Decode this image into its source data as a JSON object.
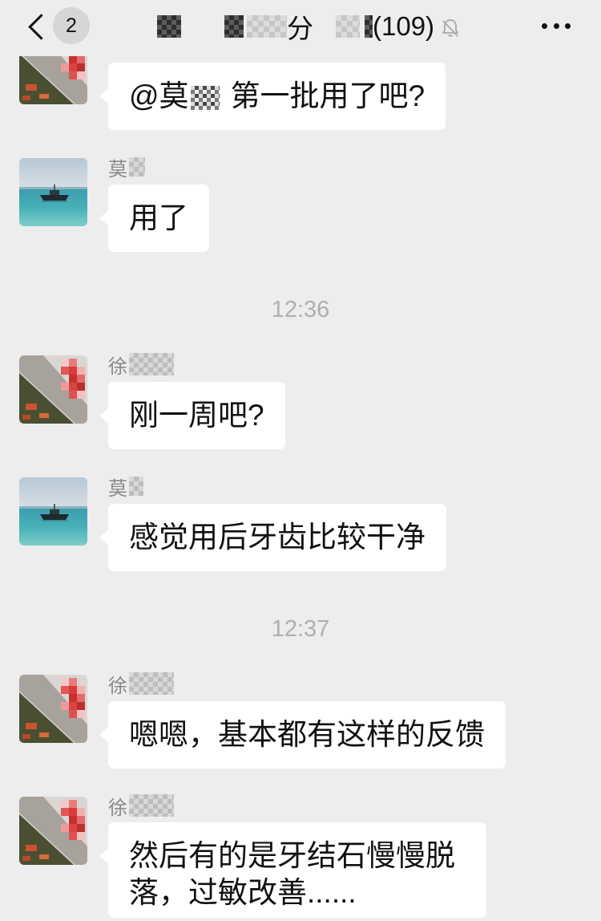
{
  "colors": {
    "background": "#ededed",
    "bubble": "#ffffff",
    "timestamp": "#afafaf",
    "sender_name": "#8a8a8a",
    "badge": "#d6d6d6"
  },
  "header": {
    "back_icon": "chevron-left-icon",
    "unread_badge": "2",
    "title_visible": "分",
    "title_count": "(109)",
    "mute_icon": "bell-off-icon",
    "more_icon": "more-dots-icon"
  },
  "messages": [
    {
      "sender": "",
      "avatar": "red-mosaic-avatar",
      "text_before": "@莫",
      "text_after": "第一批用了吧?"
    },
    {
      "sender": "莫",
      "avatar": "boat-sea-avatar",
      "text": "用了"
    },
    {
      "sender": "徐",
      "avatar": "red-mosaic-avatar",
      "text": "刚一周吧?"
    },
    {
      "sender": "莫",
      "avatar": "boat-sea-avatar",
      "text": "感觉用后牙齿比较干净"
    },
    {
      "sender": "徐",
      "avatar": "red-mosaic-avatar",
      "text": "嗯嗯，基本都有这样的反馈"
    },
    {
      "sender": "徐",
      "avatar": "red-mosaic-avatar",
      "text": "然后有的是牙结石慢慢脱落，过敏改善......"
    }
  ],
  "timestamps": [
    "12:36",
    "12:37"
  ]
}
